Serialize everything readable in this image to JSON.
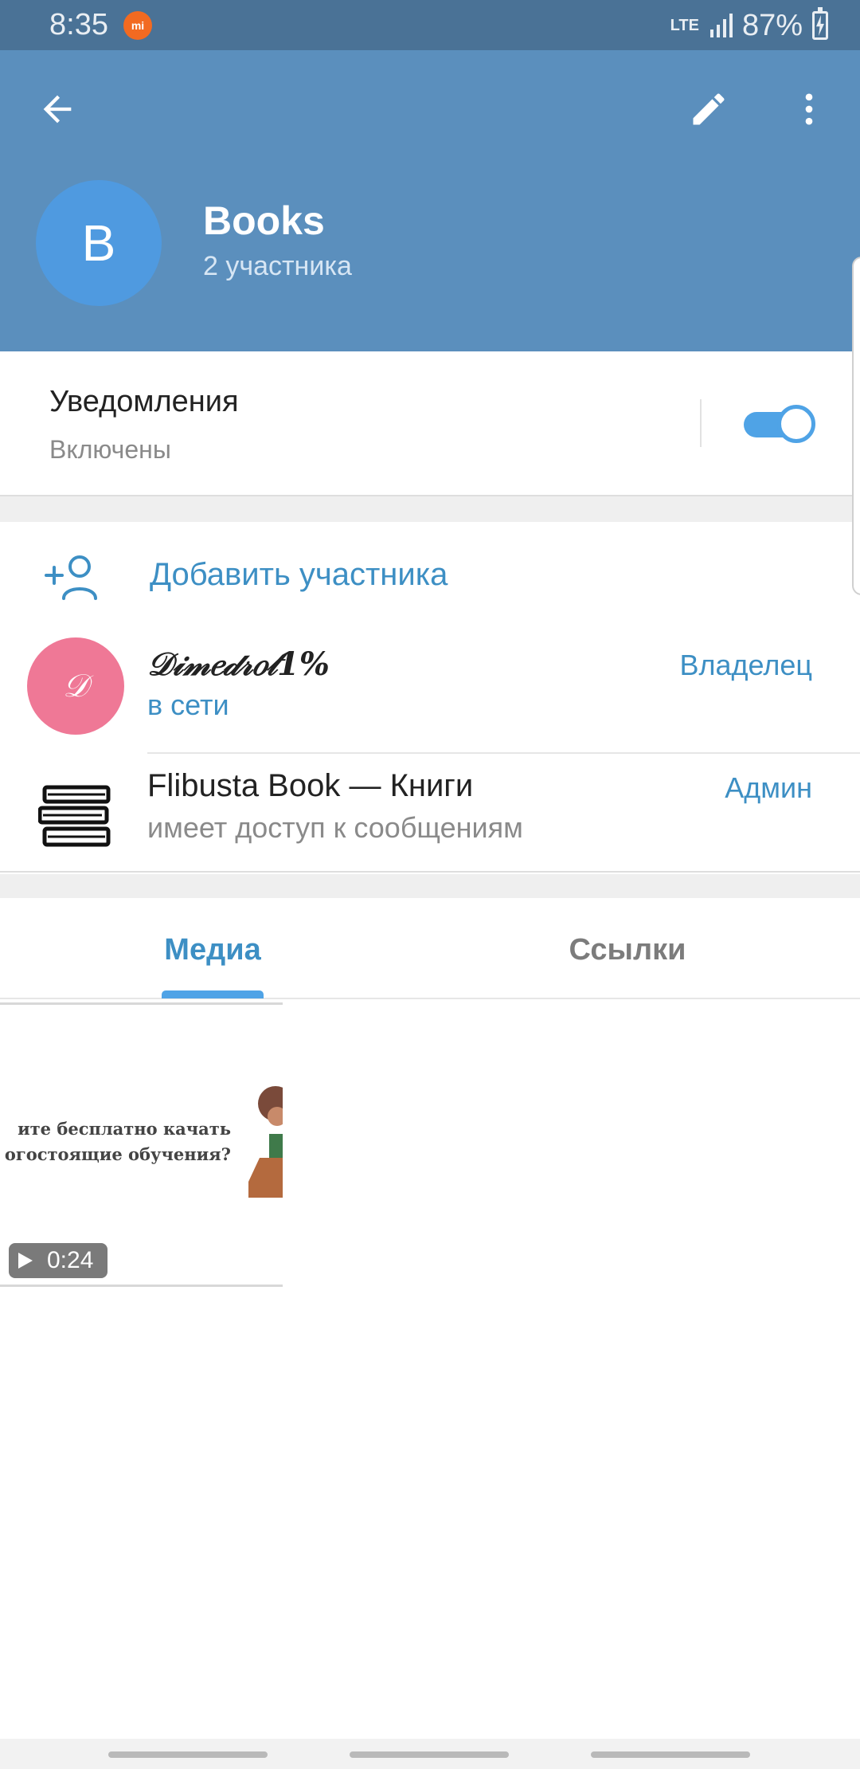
{
  "status_bar": {
    "time": "8:35",
    "network": "LTE",
    "battery_percent": "87%",
    "icons": [
      "mi-icon",
      "lte-icon",
      "signal-icon",
      "battery-charging-icon"
    ]
  },
  "header": {
    "icons": [
      "back-arrow-icon",
      "pencil-icon",
      "more-vertical-icon"
    ],
    "avatar_letter": "B",
    "title": "Books",
    "subtitle": "2 участника",
    "colors": {
      "header_bg": "#5b8fbd",
      "avatar_bg": "#4f9ae0"
    }
  },
  "notifications": {
    "title": "Уведомления",
    "status": "Включены",
    "enabled": true
  },
  "members": {
    "add_label": "Добавить участника",
    "list": [
      {
        "avatar_letter": "𝒟",
        "name": "𝒟𝒾𝓂𝑒𝒹𝓇𝑜𝓉1%",
        "status": "в сети",
        "role": "Владелец"
      },
      {
        "name": "Flibusta Book — Книги",
        "status": "имеет доступ к сообщениям",
        "role": "Админ"
      }
    ]
  },
  "tabs": {
    "items": [
      "Медиа",
      "Ссылки"
    ],
    "selected": "Медиа"
  },
  "media": {
    "thumb_text_line1": "ите бесплатно качать",
    "thumb_text_line2": "огостоящие обучения?",
    "duration": "0:24"
  },
  "colors": {
    "accent": "#3d8fc4",
    "toggle_on": "#4fa3e6"
  }
}
